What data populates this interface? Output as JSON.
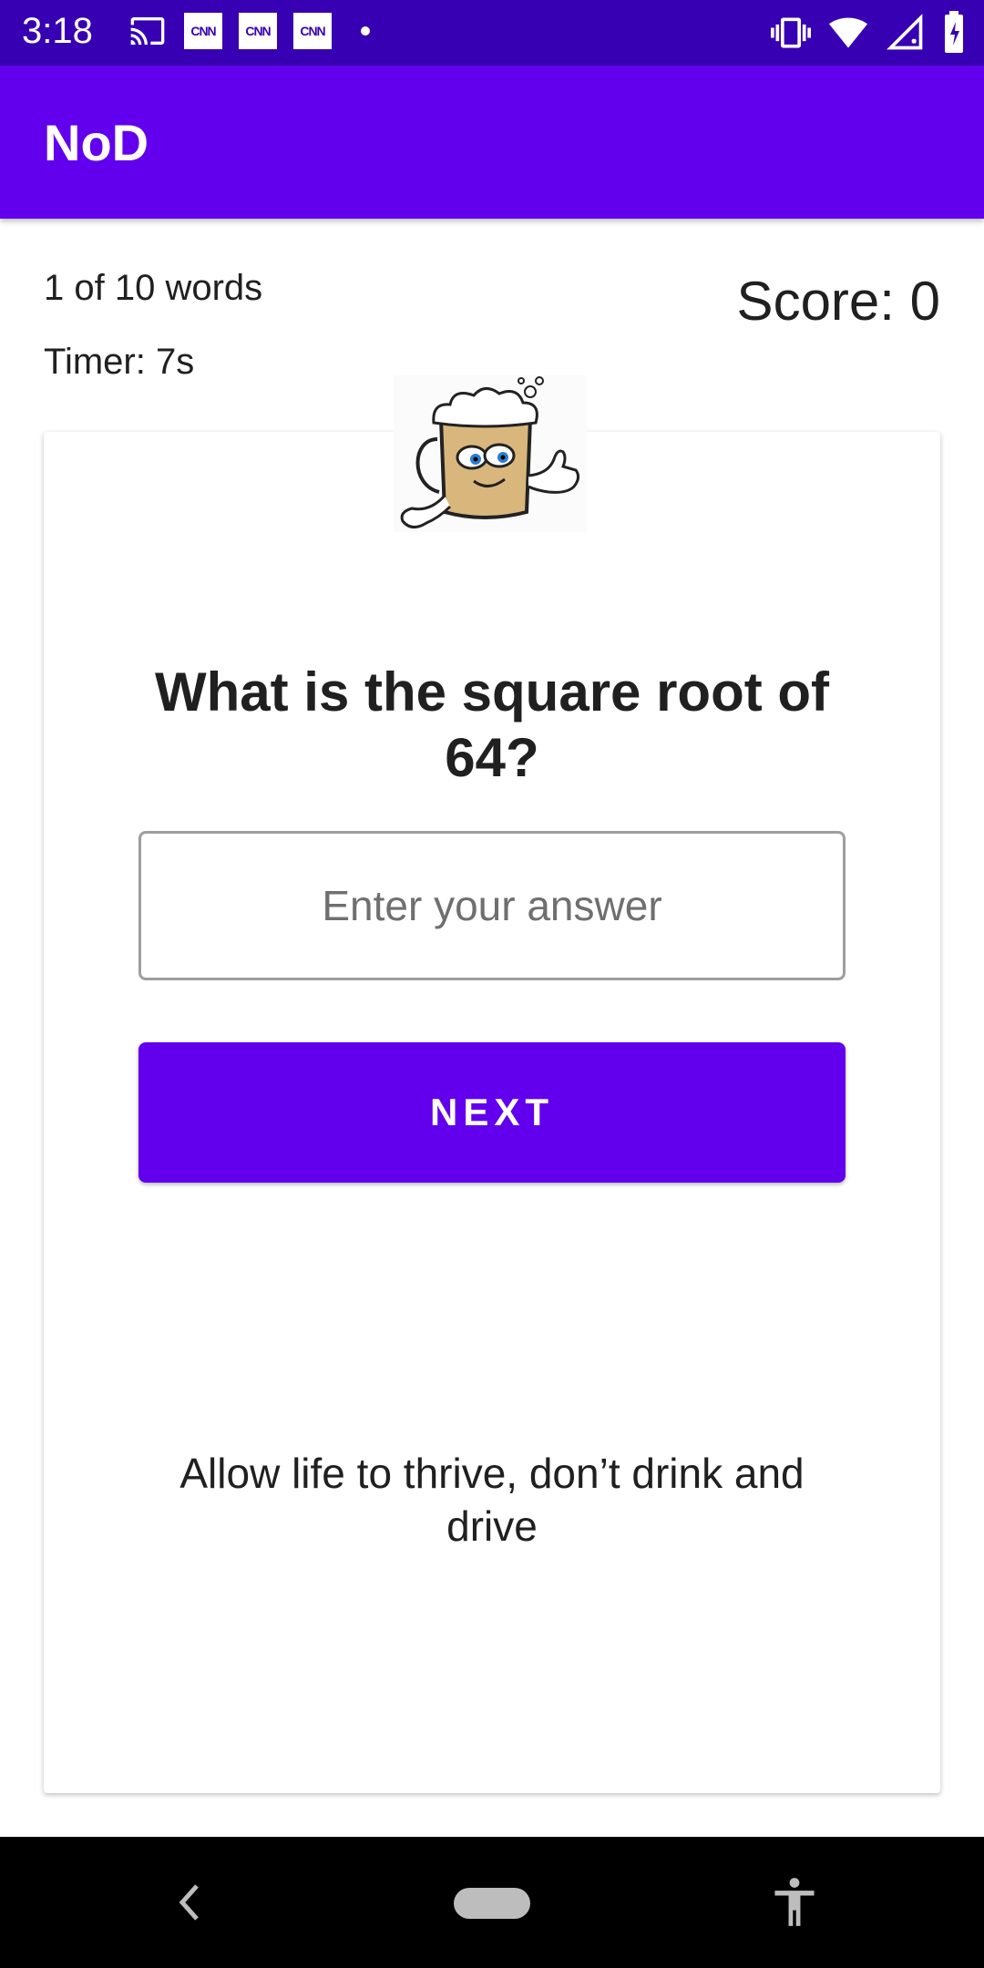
{
  "status_bar": {
    "time": "3:18",
    "cnn_badges": [
      "CNN",
      "CNN",
      "CNN"
    ],
    "icons": [
      "cast-icon",
      "vibrate-icon",
      "wifi-icon",
      "signal-icon",
      "battery-icon"
    ]
  },
  "app_bar": {
    "title": "NoD"
  },
  "quiz": {
    "progress": "1 of 10 words",
    "timer": "Timer: 7s",
    "score": "Score: 0",
    "question": "What is the square root of 64?",
    "answer_placeholder": "Enter your answer",
    "next_label": "NEXT",
    "slogan": "Allow life to thrive, don’t drink and drive"
  },
  "colors": {
    "status_bar": "#3700b3",
    "primary": "#6200ee"
  }
}
